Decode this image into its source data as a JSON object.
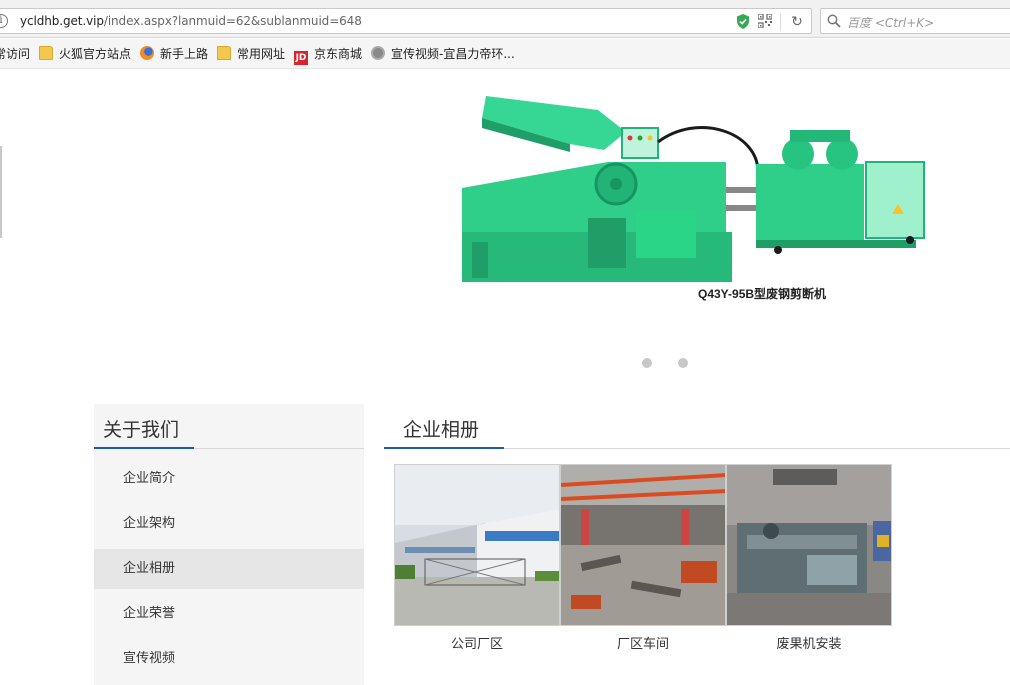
{
  "browser": {
    "url": "ycldhb.get.vip/index.aspx?lanmuid=62&sublanmuid=648",
    "url_host_part": "ycldhb.get.vip",
    "url_path_part": "/index.aspx?lanmuid=62&sublanmuid=648",
    "search_placeholder": "百度 <Ctrl+K>",
    "bookmarks": [
      {
        "label": "常访问",
        "icon": "none"
      },
      {
        "label": "火狐官方站点",
        "icon": "folder-icon"
      },
      {
        "label": "新手上路",
        "icon": "firefox-icon"
      },
      {
        "label": "常用网址",
        "icon": "folder-icon"
      },
      {
        "label": "京东商城",
        "icon": "jd-icon"
      },
      {
        "label": "宣传视频-宜昌力帝环...",
        "icon": "globe-icon"
      }
    ]
  },
  "banner": {
    "caption": "Q43Y-95B型废钢剪断机",
    "slides": 2,
    "active_slide": 1,
    "machine_color": "#2fcf8a"
  },
  "sidebar": {
    "title": "关于我们",
    "items": [
      {
        "label": "企业简介"
      },
      {
        "label": "企业架构"
      },
      {
        "label": "企业相册",
        "active": true
      },
      {
        "label": "企业荣誉"
      },
      {
        "label": "宣传视频"
      }
    ]
  },
  "content": {
    "title": "企业相册",
    "photos": [
      {
        "label": "公司厂区"
      },
      {
        "label": "厂区车间"
      },
      {
        "label": "废果机安装"
      }
    ]
  },
  "colors": {
    "accent": "#1e5aa8",
    "sidebar_bg": "#f5f5f5",
    "active_bg": "#e6e6e6"
  }
}
